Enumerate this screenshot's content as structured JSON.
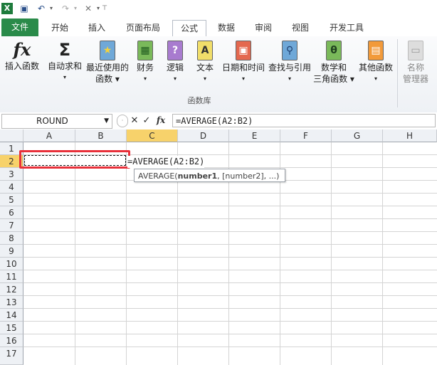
{
  "quick_access": {
    "app_icon": "excel-logo-icon",
    "items": [
      "save-icon",
      "undo-icon",
      "redo-icon",
      "tools-icon",
      "customize-icon"
    ]
  },
  "tabs": [
    "文件",
    "开始",
    "插入",
    "页面布局",
    "公式",
    "数据",
    "审阅",
    "视图",
    "开发工具"
  ],
  "ribbon": {
    "buttons": [
      {
        "label": "插入函数",
        "glyph": "fx"
      },
      {
        "label": "自动求和",
        "glyph": "Σ"
      },
      {
        "label": "最近使用的",
        "label2": "函数",
        "glyph": "★"
      },
      {
        "label": "财务",
        "glyph": "▦"
      },
      {
        "label": "逻辑",
        "glyph": "?"
      },
      {
        "label": "文本",
        "glyph": "A"
      },
      {
        "label": "日期和时间",
        "glyph": "▣"
      },
      {
        "label": "查找与引用",
        "glyph": "⚲"
      },
      {
        "label": "数学和",
        "label2": "三角函数",
        "glyph": "θ"
      },
      {
        "label": "其他函数",
        "glyph": "▤"
      },
      {
        "label": "名称",
        "label2": "管理器",
        "glyph": "▭"
      }
    ],
    "group_label": "函数库"
  },
  "formula_bar": {
    "name_box": "ROUND",
    "fx_label": "fx",
    "formula": "=AVERAGE(A2:B2)"
  },
  "grid": {
    "columns": [
      "A",
      "B",
      "C",
      "D",
      "E",
      "F",
      "G",
      "H"
    ],
    "rows": [
      "1",
      "2",
      "3",
      "4",
      "5",
      "6",
      "7",
      "8",
      "9",
      "10",
      "11",
      "12",
      "13",
      "14",
      "15",
      "16",
      "17"
    ],
    "cell_c2_text": "=AVERAGE(A2:B2)",
    "tooltip": {
      "func": "AVERAGE(",
      "arg1": "number1",
      "rest": ", [number2], ...)"
    }
  },
  "colors": {
    "file_tab": "#2a8b4a",
    "selection_highlight": "#e8303a",
    "active_col_header": "#f7d26b"
  }
}
